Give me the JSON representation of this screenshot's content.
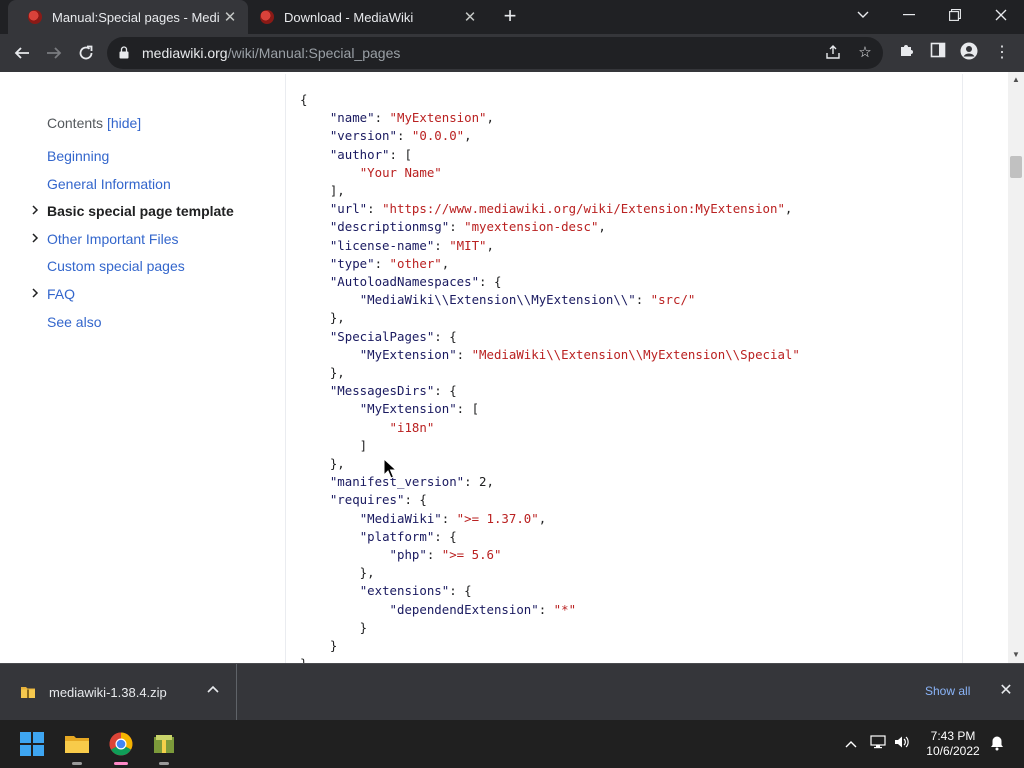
{
  "browser": {
    "tabs": [
      {
        "title": "Manual:Special pages - MediaWiki",
        "active": true
      },
      {
        "title": "Download - MediaWiki",
        "active": false
      }
    ],
    "url_host": "mediawiki.org",
    "url_path": "/wiki/Manual:Special_pages"
  },
  "toc": {
    "heading": "Contents",
    "hide_label": "[hide]",
    "items": [
      {
        "label": "Beginning",
        "expandable": false,
        "current": false
      },
      {
        "label": "General Information",
        "expandable": false,
        "current": false
      },
      {
        "label": "Basic special page template",
        "expandable": true,
        "current": true
      },
      {
        "label": "Other Important Files",
        "expandable": true,
        "current": false
      },
      {
        "label": "Custom special pages",
        "expandable": false,
        "current": false
      },
      {
        "label": "FAQ",
        "expandable": true,
        "current": false
      },
      {
        "label": "See also",
        "expandable": false,
        "current": false
      }
    ]
  },
  "code_lines": [
    "{",
    "    \"name\": \"MyExtension\",",
    "    \"version\": \"0.0.0\",",
    "    \"author\": [",
    "        \"Your Name\"",
    "    ],",
    "    \"url\": \"https://www.mediawiki.org/wiki/Extension:MyExtension\",",
    "    \"descriptionmsg\": \"myextension-desc\",",
    "    \"license-name\": \"MIT\",",
    "    \"type\": \"other\",",
    "    \"AutoloadNamespaces\": {",
    "        \"MediaWiki\\\\Extension\\\\MyExtension\\\\\": \"src/\"",
    "    },",
    "    \"SpecialPages\": {",
    "        \"MyExtension\": \"MediaWiki\\\\Extension\\\\MyExtension\\\\Special\"",
    "    },",
    "    \"MessagesDirs\": {",
    "        \"MyExtension\": [",
    "            \"i18n\"",
    "        ]",
    "    },",
    "    \"manifest_version\": 2,",
    "    \"requires\": {",
    "        \"MediaWiki\": \">= 1.37.0\",",
    "        \"platform\": {",
    "            \"php\": \">= 5.6\"",
    "        },",
    "        \"extensions\": {",
    "            \"dependendExtension\": \"*\"",
    "        }",
    "    }",
    "}"
  ],
  "downloads": {
    "file_name": "mediawiki-1.38.4.zip",
    "show_all_label": "Show all"
  },
  "taskbar": {
    "time": "7:43 PM",
    "date": "10/6/2022"
  },
  "colors": {
    "link": "#3366cc",
    "code_key": "#1a1a60",
    "code_string": "#ba2121",
    "chrome_dark": "#202124",
    "chrome_toolbar": "#35363a"
  }
}
